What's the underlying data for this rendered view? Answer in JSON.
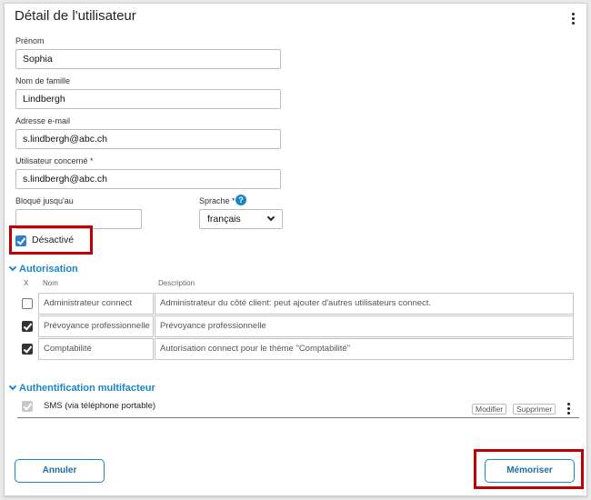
{
  "header": {
    "title": "Détail de l'utilisateur"
  },
  "form": {
    "prenom_label": "Prénom",
    "prenom_value": "Sophia",
    "nom_label": "Nom de famille",
    "nom_value": "Lindbergh",
    "email_label": "Adresse e-mail",
    "email_value": "s.lindbergh@abc.ch",
    "user_label": "Utilisateur concerné *",
    "user_value": "s.lindbergh@abc.ch",
    "blocked_label": "Bloqué jusqu'au",
    "blocked_value": "",
    "language_label": "Sprache *",
    "language_value": "français",
    "help_glyph": "?",
    "deactivated_label": "Désactivé",
    "deactivated_checked": true
  },
  "authorization": {
    "title": "Autorisation",
    "col_x": "X",
    "col_name": "Nom",
    "col_desc": "Description",
    "rows": [
      {
        "checked": false,
        "name": "Administrateur connect",
        "description": "Administrateur du côté client: peut ajouter d'autres utilisateurs connect."
      },
      {
        "checked": true,
        "name": "Prévoyance professionnelle",
        "description": "Prévoyance professionnelle"
      },
      {
        "checked": true,
        "name": "Comptabilité",
        "description": "Autorisation connect pour le thème \"Comptabilité\""
      }
    ]
  },
  "mfa": {
    "title": "Authentification multifacteur",
    "item_label": "SMS (via téléphone portable)",
    "item_checked": true,
    "modify_label": "Modifier",
    "delete_label": "Supprimer"
  },
  "footer": {
    "cancel_label": "Annuler",
    "save_label": "Mémoriser"
  },
  "colors": {
    "accent": "#1a86c8",
    "highlight": "#c00000",
    "checkbox_checked": "#333333"
  }
}
